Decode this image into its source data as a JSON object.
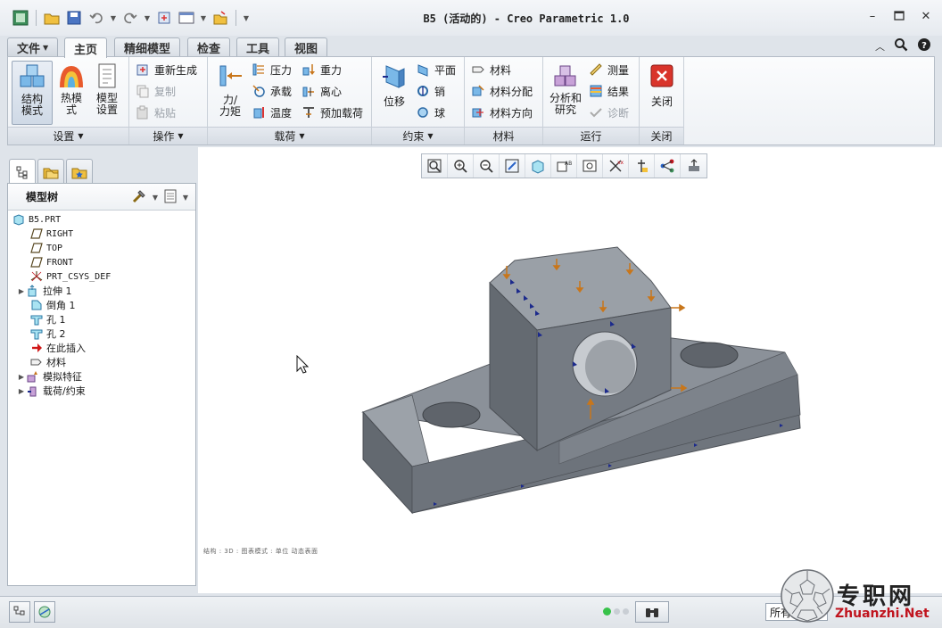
{
  "window": {
    "title": "B5 (活动的) - Creo Parametric 1.0"
  },
  "tabs": [
    {
      "label": "文件"
    },
    {
      "label": "主页"
    },
    {
      "label": "精细模型"
    },
    {
      "label": "检查"
    },
    {
      "label": "工具"
    },
    {
      "label": "视图"
    }
  ],
  "ribbon": {
    "setup": {
      "label": "设置",
      "btn_structure": "结构模式",
      "btn_thermal": "热模式",
      "btn_model_setup": "模型设置"
    },
    "ops": {
      "label": "操作",
      "regen": "重新生成",
      "copy": "复制",
      "paste": "粘贴"
    },
    "loads": {
      "label": "载荷",
      "force": "力/力矩",
      "pressure": "压力",
      "bearing": "承载",
      "temperature": "温度",
      "gravity": "重力",
      "centrifugal": "离心",
      "preload": "预加载荷"
    },
    "constraints": {
      "label": "约束",
      "displacement": "位移",
      "plane": "平面",
      "pin": "销",
      "ball": "球"
    },
    "materials": {
      "label": "材料",
      "material": "材料",
      "assign": "材料分配",
      "orientation": "材料方向"
    },
    "run": {
      "label": "运行",
      "analysis": "分析和研究",
      "measure": "测量",
      "results": "结果",
      "diagnose": "诊断"
    },
    "close": {
      "label": "关闭",
      "btn": "关闭"
    }
  },
  "tree": {
    "title": "模型树",
    "nodes": [
      {
        "label": "B5.PRT"
      },
      {
        "label": "RIGHT"
      },
      {
        "label": "TOP"
      },
      {
        "label": "FRONT"
      },
      {
        "label": "PRT_CSYS_DEF"
      },
      {
        "label": "拉伸 1"
      },
      {
        "label": "倒角 1"
      },
      {
        "label": "孔 1"
      },
      {
        "label": "孔 2"
      },
      {
        "label": "在此插入"
      },
      {
        "label": "材料"
      },
      {
        "label": "模拟特征"
      },
      {
        "label": "载荷/约束"
      }
    ]
  },
  "graphics": {
    "status_line": "结构 : 3D : 图表模式 : 单位 动态表面"
  },
  "statusbar": {
    "filter": "所有"
  },
  "watermark": {
    "text": "专职网",
    "url": "Zhuanzhi.Net"
  },
  "colors": {
    "model_face": "#7a8088",
    "constraint": "#1c2a8c",
    "load": "#c8761b"
  }
}
